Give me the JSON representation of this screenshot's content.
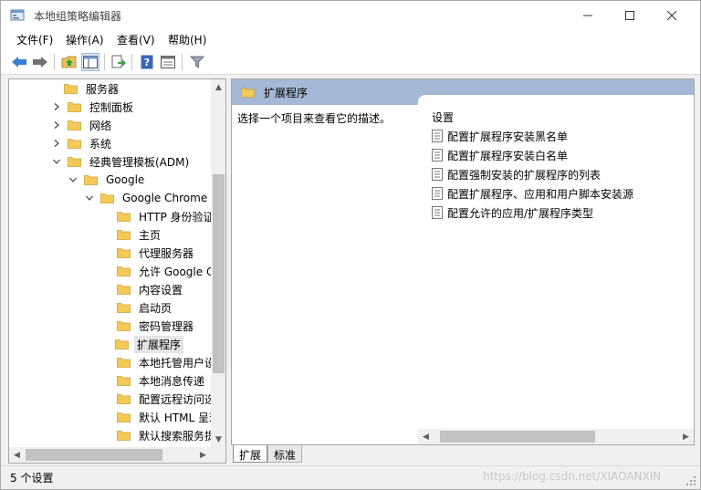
{
  "window": {
    "title": "本地组策略编辑器"
  },
  "menu": [
    "文件(F)",
    "操作(A)",
    "查看(V)",
    "帮助(H)"
  ],
  "tree": [
    {
      "label": "服务器",
      "expander": ""
    },
    {
      "label": "控制面板",
      "expander": "collapsed"
    },
    {
      "label": "网络",
      "expander": "collapsed"
    },
    {
      "label": "系统",
      "expander": "collapsed"
    },
    {
      "label": "经典管理模板(ADM)",
      "expander": "expanded"
    },
    {
      "label": "Google",
      "expander": "expanded"
    },
    {
      "label": "Google Chrome",
      "expander": "expanded"
    },
    {
      "label": "HTTP 身份验证",
      "expander": ""
    },
    {
      "label": "主页",
      "expander": ""
    },
    {
      "label": "代理服务器",
      "expander": ""
    },
    {
      "label": "允许 Google C",
      "expander": ""
    },
    {
      "label": "内容设置",
      "expander": ""
    },
    {
      "label": "启动页",
      "expander": ""
    },
    {
      "label": "密码管理器",
      "expander": ""
    },
    {
      "label": "扩展程序",
      "expander": "",
      "selected": true
    },
    {
      "label": "本地托管用户设",
      "expander": ""
    },
    {
      "label": "本地消息传递",
      "expander": ""
    },
    {
      "label": "配置远程访问选",
      "expander": ""
    },
    {
      "label": "默认 HTML 呈现",
      "expander": ""
    },
    {
      "label": "默认搜索服务提",
      "expander": ""
    }
  ],
  "right": {
    "header_title": "扩展程序",
    "description": "选择一个项目来查看它的描述。",
    "list_header": "设置",
    "items": [
      "配置扩展程序安装黑名单",
      "配置扩展程序安装白名单",
      "配置强制安装的扩展程序的列表",
      "配置扩展程序、应用和用户脚本安装源",
      "配置允许的应用/扩展程序类型"
    ]
  },
  "tabs": {
    "extended": "扩展",
    "standard": "标准"
  },
  "status": {
    "text": "5 个设置",
    "watermark": "https://blog.csdn.net/XIAOANXIN"
  },
  "colors": {
    "header_bg": "#a5b8d4",
    "folder": "#f5c955",
    "selected_bg": "#e5e5e5"
  }
}
